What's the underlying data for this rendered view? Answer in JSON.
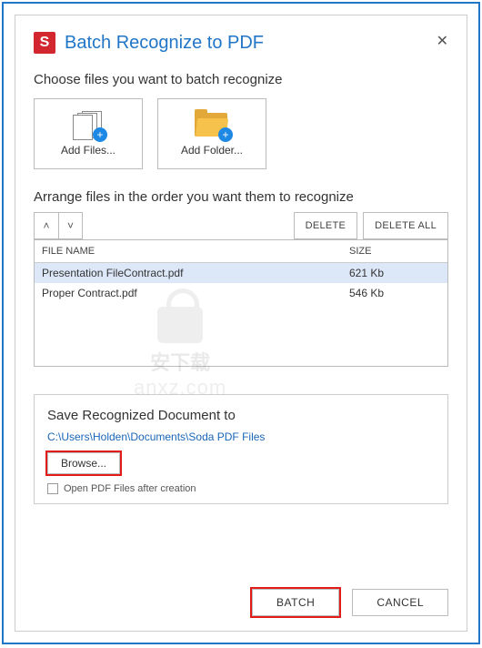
{
  "title": "Batch Recognize to PDF",
  "choose_label": "Choose files you want to batch recognize",
  "add_files_label": "Add Files...",
  "add_folder_label": "Add Folder...",
  "arrange_label": "Arrange files in the order you want them to recognize",
  "delete_label": "DELETE",
  "delete_all_label": "DELETE ALL",
  "table": {
    "col_name": "FILE NAME",
    "col_size": "SIZE",
    "rows": [
      {
        "name": "Presentation FileContract.pdf",
        "size": "621 Kb",
        "selected": true
      },
      {
        "name": "Proper Contract.pdf",
        "size": "546 Kb",
        "selected": false
      }
    ]
  },
  "save": {
    "label": "Save Recognized Document to",
    "path": "C:\\Users\\Holden\\Documents\\Soda PDF Files",
    "browse": "Browse...",
    "open_after": "Open PDF Files after creation"
  },
  "footer": {
    "batch": "BATCH",
    "cancel": "CANCEL"
  },
  "watermark": {
    "line1": "安下载",
    "line2": "anxz.com"
  },
  "app_badge": "S"
}
